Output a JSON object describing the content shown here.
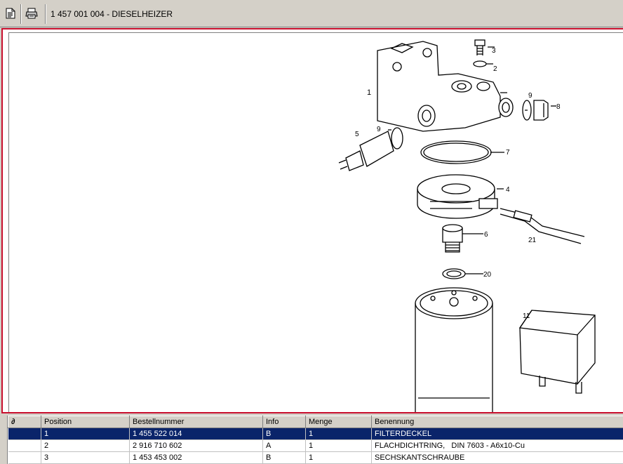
{
  "toolbar": {
    "page_icon": "document-icon",
    "print_icon": "printer-icon",
    "title": "1 457 001 004 - DIESELHEIZER"
  },
  "diagram": {
    "callouts": [
      "1",
      "2",
      "3",
      "4",
      "5",
      "6",
      "7",
      "8",
      "9",
      "9",
      "11",
      "20",
      "21"
    ]
  },
  "parts_table": {
    "columns": [
      "",
      "Position",
      "Bestellnummer",
      "Info",
      "Menge",
      "Benennung"
    ],
    "rows": [
      {
        "position": "1",
        "bestellnummer": "1 455 522 014",
        "info": "B",
        "menge": "1",
        "benennung": "FILTERDECKEL",
        "selected": true
      },
      {
        "position": "2",
        "bestellnummer": "2 916 710 602",
        "info": "A",
        "menge": "1",
        "benennung": "FLACHDICHTRING,   DIN 7603 - A6x10-Cu",
        "selected": false
      },
      {
        "position": "3",
        "bestellnummer": "1 453 453 002",
        "info": "B",
        "menge": "1",
        "benennung": "SECHSKANTSCHRAUBE",
        "selected": false
      }
    ]
  }
}
